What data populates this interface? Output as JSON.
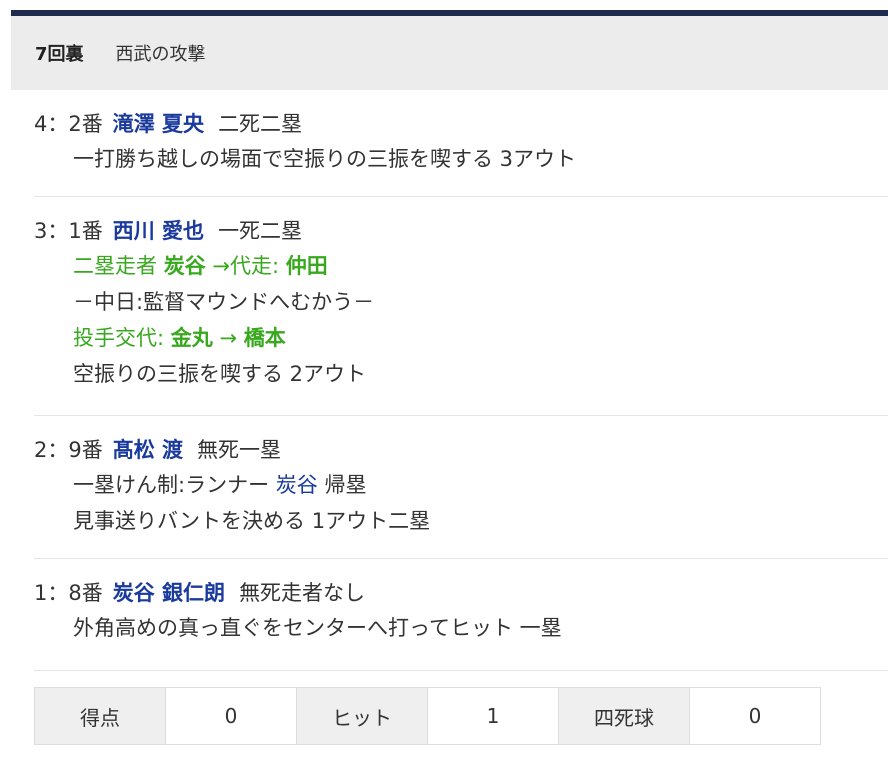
{
  "header": {
    "inning": "7回裏",
    "team_attack": "西武の攻撃"
  },
  "plays": [
    {
      "num": "4：",
      "order": "2番",
      "batter": "滝澤 夏央",
      "situation": "二死二塁",
      "result": "一打勝ち越しの場面で空振りの三振を喫する 3アウト"
    },
    {
      "num": "3：",
      "order": "1番",
      "batter": "西川 愛也",
      "situation": "一死二塁",
      "sub1_label": "二塁走者",
      "sub1_from": "炭谷",
      "sub1_arrow": "→代走:",
      "sub1_to": "仲田",
      "note": "－中日:監督マウンドへむかう－",
      "sub2_label": "投手交代:",
      "sub2_from": "金丸",
      "sub2_arrow": "→",
      "sub2_to": "橋本",
      "result": "空振りの三振を喫する 2アウト"
    },
    {
      "num": "2：",
      "order": "9番",
      "batter": "髙松 渡",
      "situation": "無死一塁",
      "detail_pre": "一塁けん制:ランナー",
      "detail_runner": "炭谷",
      "detail_post": "帰塁",
      "result": "見事送りバントを決める 1アウト二塁"
    },
    {
      "num": "1：",
      "order": "8番",
      "batter": "炭谷 銀仁朗",
      "situation": "無死走者なし",
      "result": "外角高めの真っ直ぐをセンターへ打ってヒット 一塁"
    }
  ],
  "summary": {
    "runs_label": "得点",
    "runs": "0",
    "hits_label": "ヒット",
    "hits": "1",
    "walks_label": "四死球",
    "walks": "0"
  },
  "colors": {
    "top_bar": "#1f2a4d",
    "player": "#1a3a9c",
    "substitution": "#38a81e",
    "header_bg": "#ececec"
  }
}
